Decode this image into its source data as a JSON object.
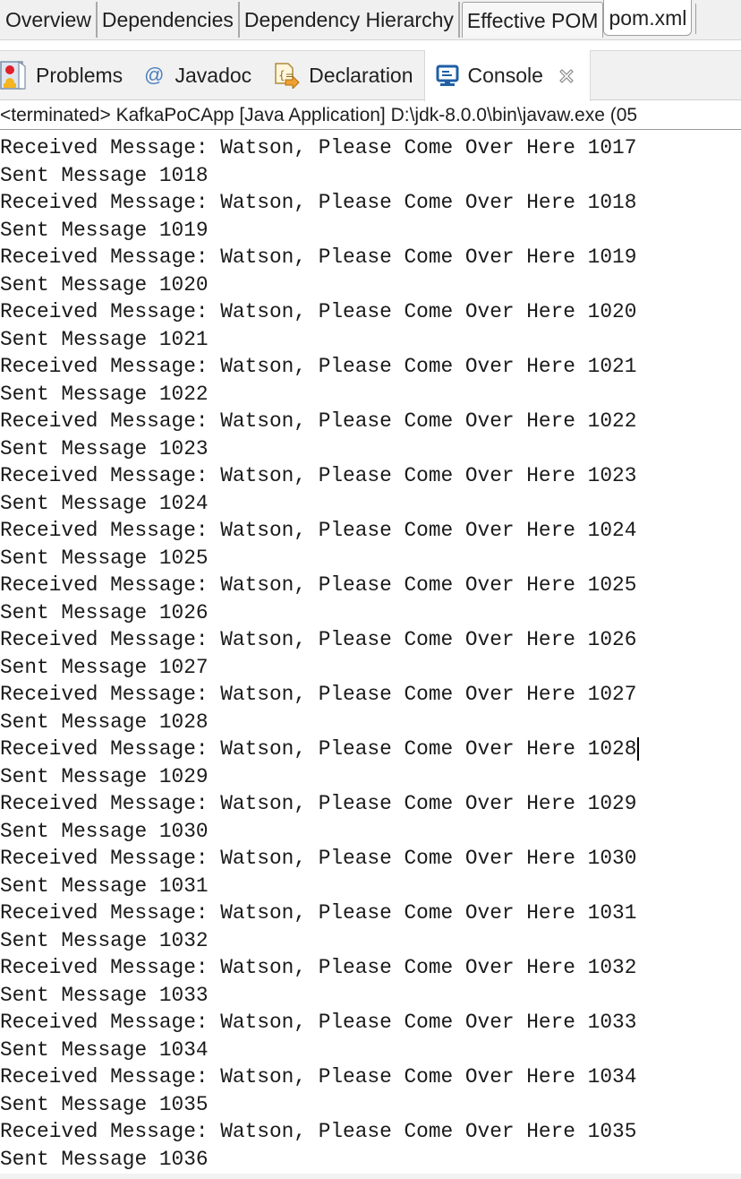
{
  "editor_tabs": [
    {
      "label": "Overview",
      "active": false
    },
    {
      "label": "Dependencies",
      "active": false
    },
    {
      "label": "Dependency Hierarchy",
      "active": false
    },
    {
      "label": "Effective POM",
      "active": true
    },
    {
      "label": "pom.xml",
      "active": false
    }
  ],
  "view_tabs": {
    "problems": {
      "label": "Problems",
      "icon": "problems-icon"
    },
    "javadoc": {
      "label": "Javadoc",
      "icon": "at-sign-icon",
      "glyph": "@"
    },
    "declaration": {
      "label": "Declaration",
      "icon": "declaration-icon"
    },
    "console": {
      "label": "Console",
      "icon": "console-icon",
      "active": true,
      "close_icon": "close-icon"
    }
  },
  "console": {
    "header": "<terminated> KafkaPoCApp [Java Application] D:\\jdk-8.0.0\\bin\\javaw.exe  (05",
    "caret_after_line": 22,
    "lines": [
      "Received Message: Watson, Please Come Over Here 1017",
      "Sent Message 1018",
      "Received Message: Watson, Please Come Over Here 1018",
      "Sent Message 1019",
      "Received Message: Watson, Please Come Over Here 1019",
      "Sent Message 1020",
      "Received Message: Watson, Please Come Over Here 1020",
      "Sent Message 1021",
      "Received Message: Watson, Please Come Over Here 1021",
      "Sent Message 1022",
      "Received Message: Watson, Please Come Over Here 1022",
      "Sent Message 1023",
      "Received Message: Watson, Please Come Over Here 1023",
      "Sent Message 1024",
      "Received Message: Watson, Please Come Over Here 1024",
      "Sent Message 1025",
      "Received Message: Watson, Please Come Over Here 1025",
      "Sent Message 1026",
      "Received Message: Watson, Please Come Over Here 1026",
      "Sent Message 1027",
      "Received Message: Watson, Please Come Over Here 1027",
      "Sent Message 1028",
      "Received Message: Watson, Please Come Over Here 1028",
      "Sent Message 1029",
      "Received Message: Watson, Please Come Over Here 1029",
      "Sent Message 1030",
      "Received Message: Watson, Please Come Over Here 1030",
      "Sent Message 1031",
      "Received Message: Watson, Please Come Over Here 1031",
      "Sent Message 1032",
      "Received Message: Watson, Please Come Over Here 1032",
      "Sent Message 1033",
      "Received Message: Watson, Please Come Over Here 1033",
      "Sent Message 1034",
      "Received Message: Watson, Please Come Over Here 1034",
      "Sent Message 1035",
      "Received Message: Watson, Please Come Over Here 1035",
      "Sent Message 1036"
    ]
  }
}
